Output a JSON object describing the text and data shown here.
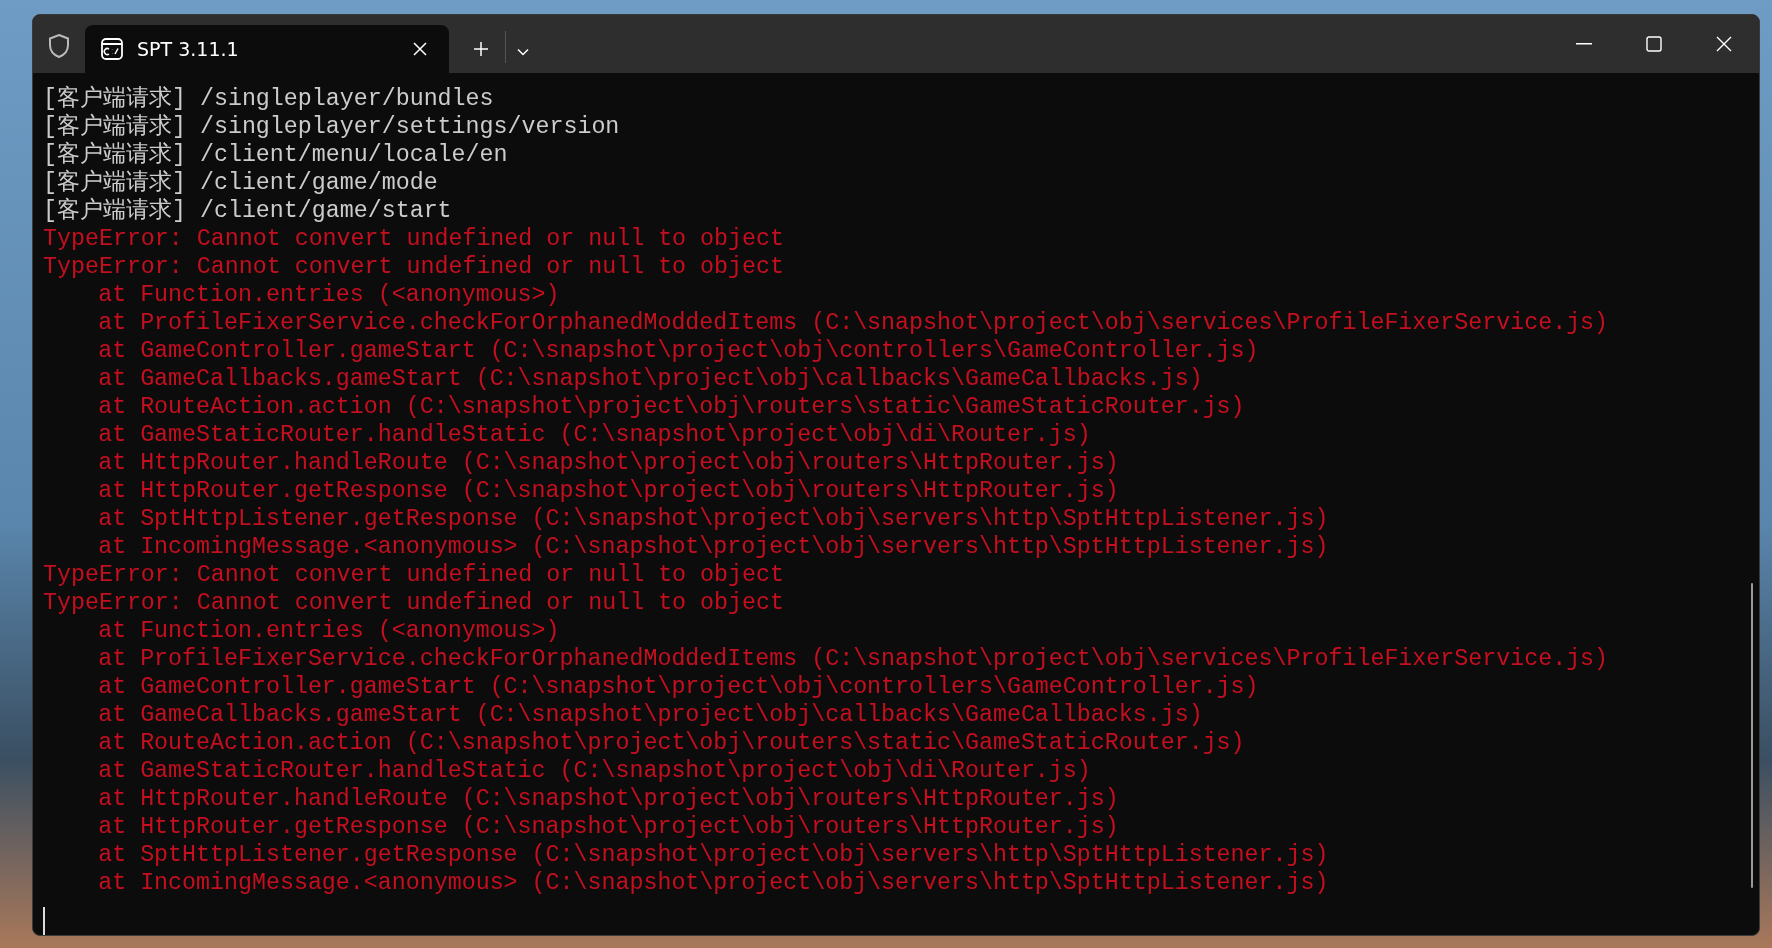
{
  "tab": {
    "title": "SPT 3.11.1",
    "selected": true
  },
  "lines": [
    {
      "kind": "info",
      "text": "[客户端请求] /singleplayer/bundles"
    },
    {
      "kind": "info",
      "text": "[客户端请求] /singleplayer/settings/version"
    },
    {
      "kind": "info",
      "text": "[客户端请求] /client/menu/locale/en"
    },
    {
      "kind": "info",
      "text": "[客户端请求] /client/game/mode"
    },
    {
      "kind": "info",
      "text": "[客户端请求] /client/game/start"
    },
    {
      "kind": "error",
      "text": "TypeError: Cannot convert undefined or null to object"
    },
    {
      "kind": "error",
      "text": "TypeError: Cannot convert undefined or null to object"
    },
    {
      "kind": "trace",
      "text": "at Function.entries (<anonymous>)"
    },
    {
      "kind": "trace",
      "text": "at ProfileFixerService.checkForOrphanedModdedItems (C:\\snapshot\\project\\obj\\services\\ProfileFixerService.js)"
    },
    {
      "kind": "trace",
      "text": "at GameController.gameStart (C:\\snapshot\\project\\obj\\controllers\\GameController.js)"
    },
    {
      "kind": "trace",
      "text": "at GameCallbacks.gameStart (C:\\snapshot\\project\\obj\\callbacks\\GameCallbacks.js)"
    },
    {
      "kind": "trace",
      "text": "at RouteAction.action (C:\\snapshot\\project\\obj\\routers\\static\\GameStaticRouter.js)"
    },
    {
      "kind": "trace",
      "text": "at GameStaticRouter.handleStatic (C:\\snapshot\\project\\obj\\di\\Router.js)"
    },
    {
      "kind": "trace",
      "text": "at HttpRouter.handleRoute (C:\\snapshot\\project\\obj\\routers\\HttpRouter.js)"
    },
    {
      "kind": "trace",
      "text": "at HttpRouter.getResponse (C:\\snapshot\\project\\obj\\routers\\HttpRouter.js)"
    },
    {
      "kind": "trace",
      "text": "at SptHttpListener.getResponse (C:\\snapshot\\project\\obj\\servers\\http\\SptHttpListener.js)"
    },
    {
      "kind": "trace",
      "text": "at IncomingMessage.<anonymous> (C:\\snapshot\\project\\obj\\servers\\http\\SptHttpListener.js)"
    },
    {
      "kind": "error",
      "text": "TypeError: Cannot convert undefined or null to object"
    },
    {
      "kind": "error",
      "text": "TypeError: Cannot convert undefined or null to object"
    },
    {
      "kind": "trace",
      "text": "at Function.entries (<anonymous>)"
    },
    {
      "kind": "trace",
      "text": "at ProfileFixerService.checkForOrphanedModdedItems (C:\\snapshot\\project\\obj\\services\\ProfileFixerService.js)"
    },
    {
      "kind": "trace",
      "text": "at GameController.gameStart (C:\\snapshot\\project\\obj\\controllers\\GameController.js)"
    },
    {
      "kind": "trace",
      "text": "at GameCallbacks.gameStart (C:\\snapshot\\project\\obj\\callbacks\\GameCallbacks.js)"
    },
    {
      "kind": "trace",
      "text": "at RouteAction.action (C:\\snapshot\\project\\obj\\routers\\static\\GameStaticRouter.js)"
    },
    {
      "kind": "trace",
      "text": "at GameStaticRouter.handleStatic (C:\\snapshot\\project\\obj\\di\\Router.js)"
    },
    {
      "kind": "trace",
      "text": "at HttpRouter.handleRoute (C:\\snapshot\\project\\obj\\routers\\HttpRouter.js)"
    },
    {
      "kind": "trace",
      "text": "at HttpRouter.getResponse (C:\\snapshot\\project\\obj\\routers\\HttpRouter.js)"
    },
    {
      "kind": "trace",
      "text": "at SptHttpListener.getResponse (C:\\snapshot\\project\\obj\\servers\\http\\SptHttpListener.js)"
    },
    {
      "kind": "trace",
      "text": "at IncomingMessage.<anonymous> (C:\\snapshot\\project\\obj\\servers\\http\\SptHttpListener.js)"
    }
  ]
}
